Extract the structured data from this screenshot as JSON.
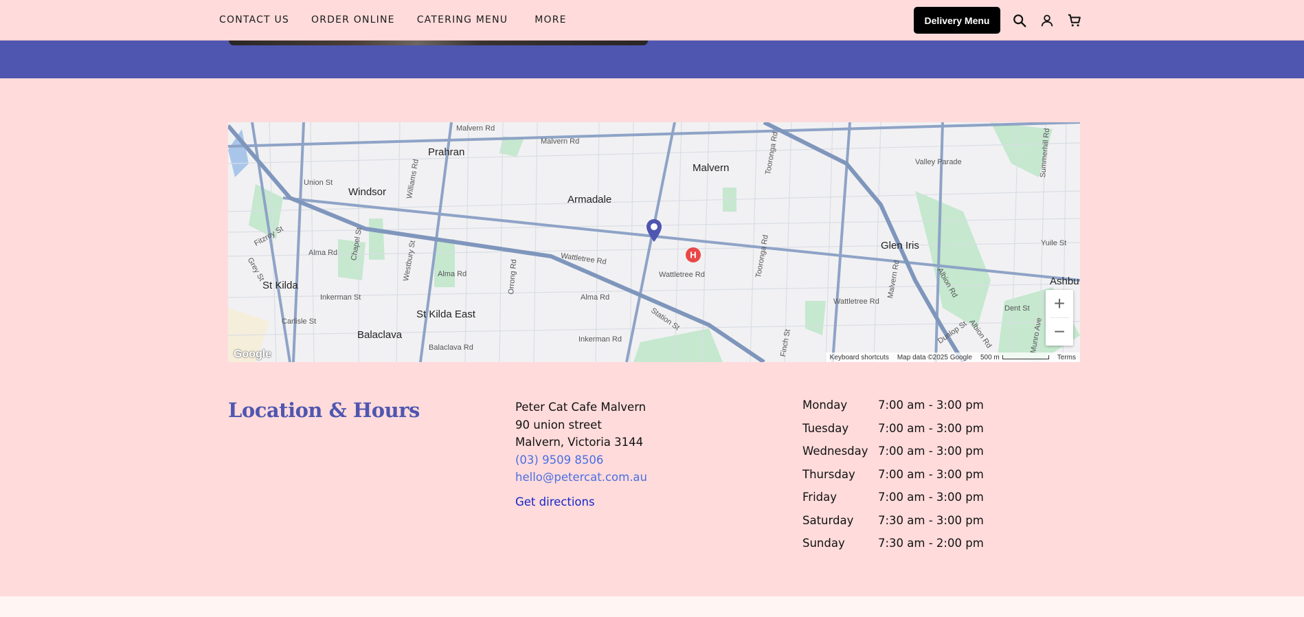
{
  "nav": {
    "items": [
      "CONTACT US",
      "ORDER ONLINE",
      "CATERING MENU",
      "MORE"
    ],
    "delivery_button": "Delivery Menu",
    "icons": [
      "search-icon",
      "account-icon",
      "cart-icon"
    ]
  },
  "colors": {
    "accent": "#4f56b0",
    "background": "#ffdbdb",
    "link": "#4a6fe3"
  },
  "map": {
    "suburbs": [
      "Prahran",
      "Malvern",
      "Windsor",
      "Armadale",
      "Glen Iris",
      "St Kilda",
      "St Kilda East",
      "Balaclava",
      "Ashbu"
    ],
    "streets": [
      "Malvern Rd",
      "Malvern Rd",
      "Valley Parade",
      "Union St",
      "Williams Rd",
      "Toorak Rd",
      "Tooronga Rd",
      "Fitzroy St",
      "Chapel St",
      "Alma Rd",
      "Westbury St",
      "Orrong Rd",
      "Wattletree Rd",
      "Wattletree Rd",
      "Tooronga Rd",
      "Malvern Rd",
      "Yuile St",
      "Albion Rd",
      "Grey St",
      "Alma Rd",
      "Wattletree Rd",
      "Inkerman St",
      "Alma Rd",
      "Station St",
      "Dent St",
      "Carlisle St",
      "Dunlop St",
      "Albion Rd",
      "Munro Ave",
      "Balaclava Rd",
      "Inkerman Rd",
      "Finch St",
      "Summerhill Rd"
    ],
    "zoom_in": "+",
    "zoom_out": "−",
    "attribution": [
      "Keyboard shortcuts",
      "Map data ©2025 Google",
      "500 m",
      "Terms"
    ],
    "logo": "Google"
  },
  "location": {
    "title": "Location & Hours",
    "name": "Peter Cat Cafe Malvern",
    "street": "90 union street",
    "city": "Malvern, Victoria 3144",
    "phone": "(03) 9509 8506",
    "email": "hello@petercat.com.au",
    "directions": "Get directions"
  },
  "hours": [
    {
      "day": "Monday",
      "time": "7:00 am - 3:00 pm"
    },
    {
      "day": "Tuesday",
      "time": "7:00 am - 3:00 pm"
    },
    {
      "day": "Wednesday",
      "time": "7:00 am - 3:00 pm"
    },
    {
      "day": "Thursday",
      "time": "7:00 am - 3:00 pm"
    },
    {
      "day": "Friday",
      "time": "7:00 am - 3:00 pm"
    },
    {
      "day": "Saturday",
      "time": "7:30 am - 3:00 pm"
    },
    {
      "day": "Sunday",
      "time": "7:30 am - 2:00 pm"
    }
  ]
}
